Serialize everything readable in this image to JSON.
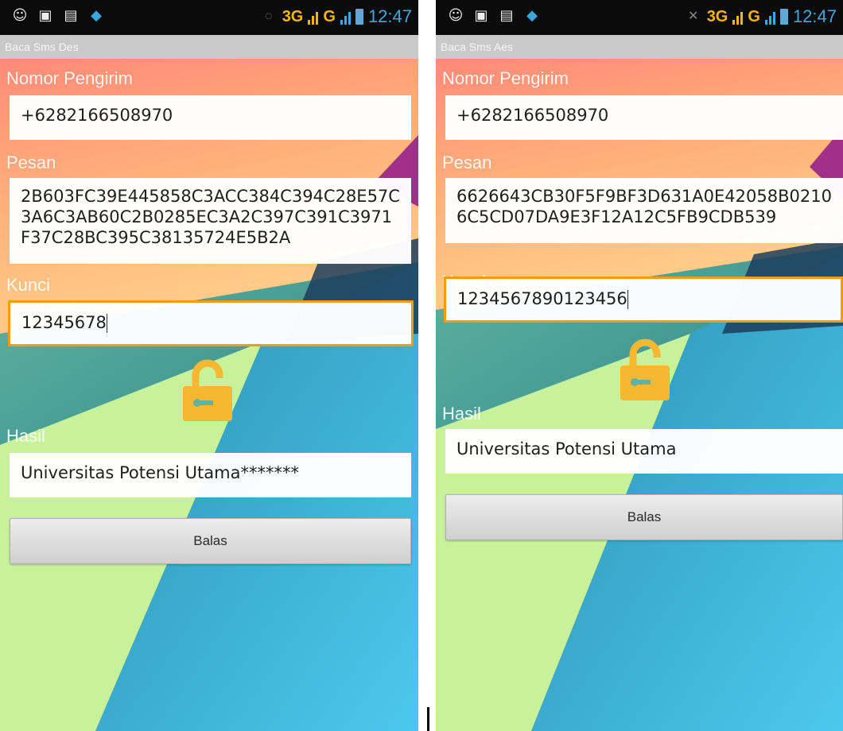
{
  "status_bar": {
    "network_label": "3G",
    "network_label_2": "G",
    "time": "12:47"
  },
  "screens": [
    {
      "title": "Baca Sms Des",
      "sender_label": "Nomor Pengirim",
      "sender_value": "+6282166508970",
      "message_label": "Pesan",
      "message_value": "2B603FC39E445858C3ACC384C394C28E57C3A6C3AB60C2B0285EC3A2C397C391C3971F37C28BC395C38135724E5B2A",
      "key_label": "Kunci",
      "key_value": "12345678",
      "result_label": "Hasil",
      "result_value": "Universitas Potensi Utama*******",
      "reply_button": "Balas",
      "lock_icon": "unlock-icon",
      "lock_color": "#f7b731"
    },
    {
      "title": "Baca Sms Aes",
      "sender_label": "Nomor Pengirim",
      "sender_value": "+6282166508970",
      "message_label": "Pesan",
      "message_value": "6626643CB30F5F9BF3D631A0E42058B02106C5CD07DA9E3F12A12C5FB9CDB539",
      "key_label": "Kunci",
      "key_value": "1234567890123456",
      "result_label": "Hasil",
      "result_value": "Universitas Potensi Utama",
      "reply_button": "Balas",
      "lock_icon": "unlock-icon",
      "lock_color": "#f7b731"
    }
  ]
}
